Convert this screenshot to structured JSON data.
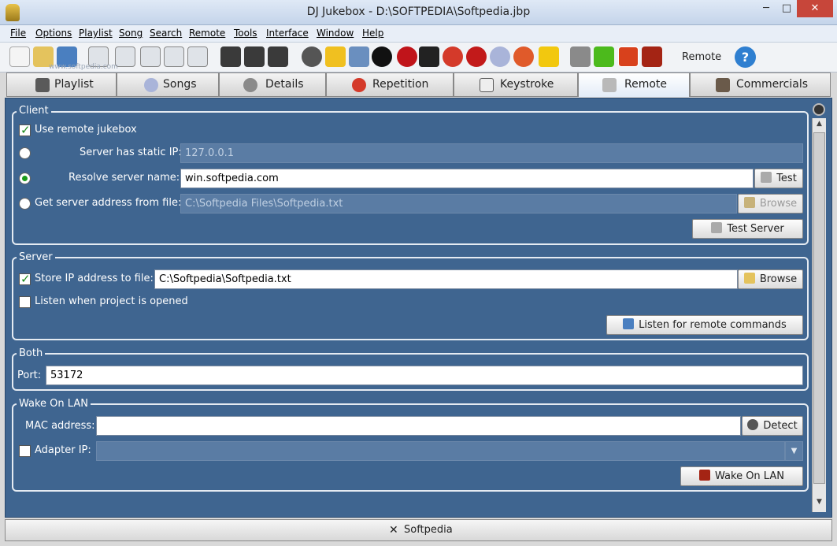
{
  "window": {
    "title": "DJ Jukebox - D:\\SOFTPEDIA\\Softpedia.jbp",
    "min": "─",
    "max": "□",
    "close": "✕"
  },
  "menu": [
    "File",
    "Options",
    "Playlist",
    "Song",
    "Search",
    "Remote",
    "Tools",
    "Interface",
    "Window",
    "Help"
  ],
  "toolbar": {
    "remote_label": "Remote",
    "help": "?",
    "watermark": "www.softpedia.com"
  },
  "tabs": [
    {
      "label": "Playlist",
      "icon": "music-note-icon"
    },
    {
      "label": "Songs",
      "icon": "cd-icon"
    },
    {
      "label": "Details",
      "icon": "gear-icon"
    },
    {
      "label": "Repetition",
      "icon": "repeat-icon"
    },
    {
      "label": "Keystroke",
      "icon": "key-icon"
    },
    {
      "label": "Remote",
      "icon": "remote-icon"
    },
    {
      "label": "Commercials",
      "icon": "tv-icon"
    }
  ],
  "client": {
    "title": "Client",
    "use_remote": "Use remote jukebox",
    "static_ip_label": "Server has static IP:",
    "static_ip_value": "127.0.0.1",
    "resolve_label": "Resolve server name:",
    "resolve_value": "win.softpedia.com",
    "test_btn": "Test",
    "file_label": "Get server address from file:",
    "file_value": "C:\\Softpedia Files\\Softpedia.txt",
    "browse_btn": "Browse",
    "test_server_btn": "Test Server"
  },
  "server": {
    "title": "Server",
    "store_label": "Store IP address to file:",
    "store_value": "C:\\Softpedia\\Softpedia.txt",
    "browse_btn": "Browse",
    "listen_label": "Listen when project is opened",
    "listen_btn": "Listen for remote commands"
  },
  "both": {
    "title": "Both",
    "port_label": "Port:",
    "port_value": "53172"
  },
  "wol": {
    "title": "Wake On LAN",
    "mac_label": "MAC address:",
    "mac_value": "",
    "detect_btn": "Detect",
    "adapter_label": "Adapter IP:",
    "adapter_value": "",
    "wake_btn": "Wake On LAN"
  },
  "status": {
    "close_label": "Softpedia",
    "x": "✕"
  },
  "colors": {
    "panel": "#3f6590",
    "accent_green": "#1a9a1a"
  }
}
